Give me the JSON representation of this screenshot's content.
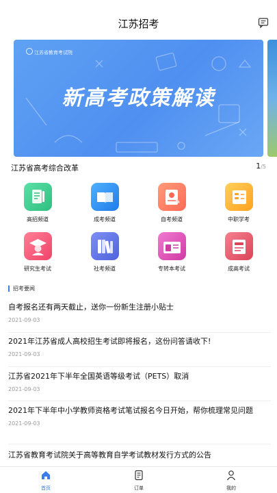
{
  "header": {
    "title": "江苏招考",
    "message_icon": "message-icon"
  },
  "banner": {
    "org": "江苏省教育考试院",
    "headline": "新高考政策解读",
    "caption": "江苏省高考综合改革",
    "page_current": "1",
    "page_total": "/5"
  },
  "grid": [
    {
      "label": "高招频道",
      "icon": "gaozhao-icon",
      "color": "#36c98c"
    },
    {
      "label": "成考频道",
      "icon": "book-icon",
      "color": "#2f8ff0"
    },
    {
      "label": "自考频道",
      "icon": "certificate-icon",
      "color": "#ff7a5e"
    },
    {
      "label": "中职学考",
      "icon": "document-icon",
      "color": "#ffb23d"
    },
    {
      "label": "研究生考试",
      "icon": "graduate-icon",
      "color": "#ff5d7a"
    },
    {
      "label": "社考频道",
      "icon": "books-icon",
      "color": "#5d73e8"
    },
    {
      "label": "专转本考试",
      "icon": "upgrade-icon",
      "color": "#e44fb0"
    },
    {
      "label": "成高考试",
      "icon": "exam-book-icon",
      "color": "#ee5a6f"
    }
  ],
  "section": {
    "title": "招考要闻"
  },
  "news": [
    {
      "title": "自考报名还有两天截止，送你一份新生注册小贴士",
      "date": "2021-09-03"
    },
    {
      "title": "2021年江苏省成人高校招生考试即将报名，这份问答请收下!",
      "date": "2021-09-03"
    },
    {
      "title": "江苏省2021年下半年全国英语等级考试（PETS）取消",
      "date": "2021-09-03"
    },
    {
      "title": "2021年下半年中小学教师资格考试笔试报名今日开始，帮你梳理常见问题",
      "date": "2021-09-03"
    },
    {
      "title": "江苏省教育考试院关于高等教育自学考试教材发行方式的公告",
      "date": ""
    }
  ],
  "tabbar": {
    "items": [
      {
        "label": "首页",
        "icon": "home-icon"
      },
      {
        "label": "订单",
        "icon": "order-icon"
      },
      {
        "label": "我的",
        "icon": "user-icon"
      }
    ],
    "active_color": "#3b7bea"
  }
}
